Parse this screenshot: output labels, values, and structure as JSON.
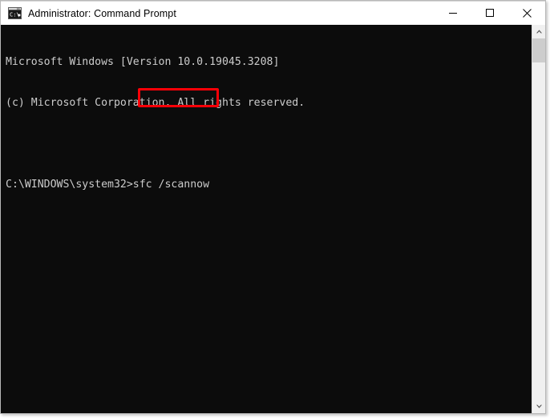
{
  "window": {
    "title": "Administrator: Command Prompt",
    "icon": "console-window-icon",
    "controls": {
      "minimize": "Minimize",
      "maximize": "Maximize",
      "close": "Close"
    }
  },
  "console": {
    "background_color": "#0c0c0c",
    "text_color": "#cccccc",
    "lines": [
      "Microsoft Windows [Version 10.0.19045.3208]",
      "(c) Microsoft Corporation. All rights reserved.",
      "",
      "C:\\WINDOWS\\system32>sfc /scannow"
    ],
    "prompt": "C:\\WINDOWS\\system32>",
    "typed_command": "sfc /scannow"
  },
  "annotation": {
    "highlight_color": "#fb0007",
    "target_text": "sfc /scannow",
    "name": "red-highlight-box"
  },
  "scrollbar": {
    "up_arrow": "scroll-up-arrow-icon",
    "down_arrow": "scroll-down-arrow-icon",
    "thumb": "scrollbar-thumb"
  }
}
